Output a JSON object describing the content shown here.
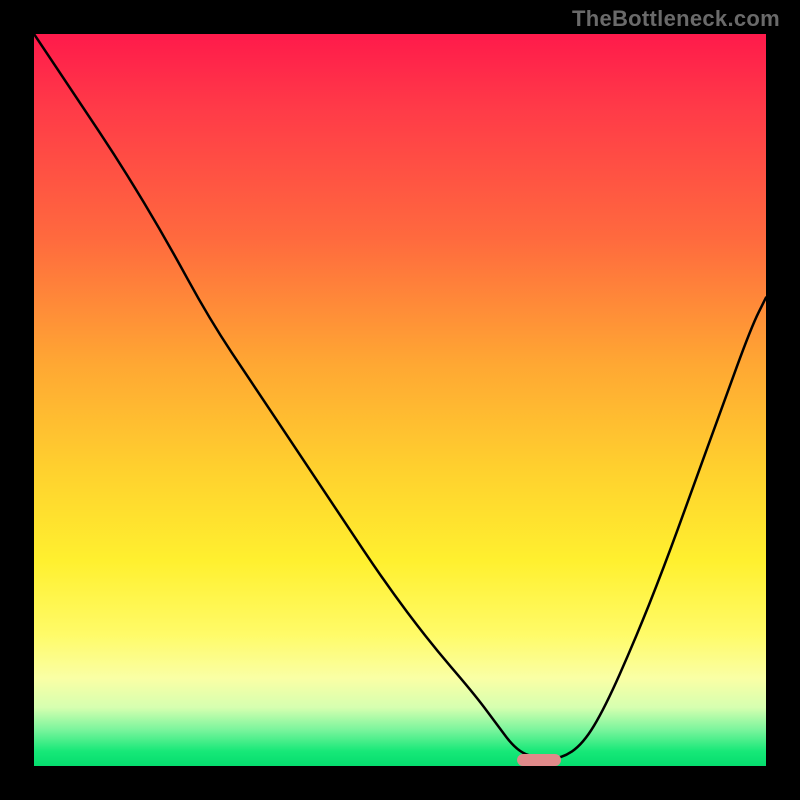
{
  "attribution": "TheBottleneck.com",
  "colors": {
    "frame": "#000000",
    "attribution_text": "#6a6a6a",
    "curve_stroke": "#000000",
    "marker_fill": "#e08a8a",
    "gradient_top": "#ff1a4b",
    "gradient_bottom": "#05dd6e"
  },
  "chart_data": {
    "type": "line",
    "title": "",
    "xlabel": "",
    "ylabel": "",
    "xlim": [
      0,
      100
    ],
    "ylim": [
      0,
      100
    ],
    "grid": false,
    "legend": false,
    "note": "x/y are normalized to the plot-area. y=0 is the bottom (green band), y=100 is the top (red band). The curve is a single black performance/bottleneck trace: steep descent from top-left, flat minimum near x≈66–72, then rising toward top-right. A pink pill marks the minimum.",
    "series": [
      {
        "name": "bottleneck-curve",
        "x": [
          0,
          6,
          12,
          18,
          24,
          30,
          36,
          42,
          48,
          54,
          60,
          63,
          66,
          69,
          72,
          75,
          78,
          82,
          86,
          90,
          94,
          98,
          100
        ],
        "y": [
          100,
          91,
          82,
          72,
          61,
          52,
          43,
          34,
          25,
          17,
          10,
          6,
          2,
          1,
          1,
          3,
          8,
          17,
          27,
          38,
          49,
          60,
          64
        ]
      }
    ],
    "marker": {
      "name": "minimum-marker",
      "x": 69,
      "y": 0.8,
      "width_pct": 6
    }
  }
}
